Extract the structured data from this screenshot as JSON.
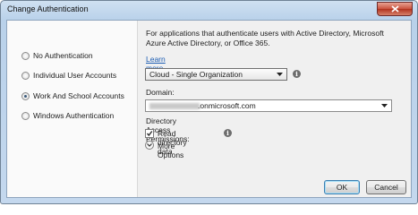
{
  "window": {
    "title": "Change Authentication"
  },
  "auth_options": [
    {
      "label": "No Authentication",
      "selected": false
    },
    {
      "label": "Individual User Accounts",
      "selected": false
    },
    {
      "label": "Work And School Accounts",
      "selected": true
    },
    {
      "label": "Windows Authentication",
      "selected": false
    }
  ],
  "details": {
    "description": "For applications that authenticate users with Active Directory, Microsoft Azure Active Directory, or Office 365.",
    "learn_more": "Learn more",
    "type_select": {
      "value": "Cloud - Single Organization",
      "info_icon": "info-icon"
    },
    "domain": {
      "label": "Domain:",
      "value_suffix": ".onmicrosoft.com"
    },
    "permissions": {
      "label": "Directory Access Permissions:",
      "read_directory": "Read directory data",
      "checked": true
    },
    "more_options": "More Options"
  },
  "buttons": {
    "ok": "OK",
    "cancel": "Cancel"
  },
  "colors": {
    "link": "#1c5db3",
    "title_bar": "#b9d1ea",
    "close_button": "#c9503c"
  }
}
